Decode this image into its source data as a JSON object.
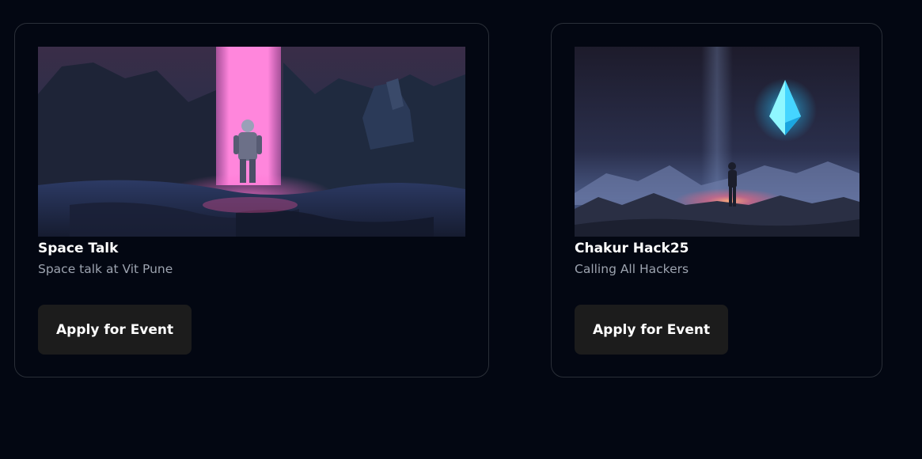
{
  "events": [
    {
      "title": "Space Talk",
      "subtitle": "Space talk at Vit Pune",
      "button_label": "Apply for Event"
    },
    {
      "title": "Chakur Hack25",
      "subtitle": "Calling All Hackers",
      "button_label": "Apply for Event"
    }
  ]
}
